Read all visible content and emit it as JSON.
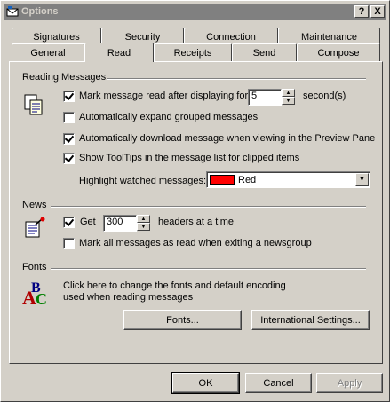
{
  "window": {
    "title": "Options",
    "help_btn": "?",
    "close_btn": "X"
  },
  "tabs": {
    "back_row": [
      "Signatures",
      "Security",
      "Connection",
      "Maintenance"
    ],
    "front_row": [
      "General",
      "Read",
      "Receipts",
      "Send",
      "Compose"
    ],
    "active": "Read"
  },
  "reading": {
    "title": "Reading Messages",
    "mark_read_label": "Mark message read after displaying for",
    "mark_read_checked": true,
    "mark_read_seconds": "5",
    "seconds_label": "second(s)",
    "expand_label": "Automatically expand grouped messages",
    "expand_checked": false,
    "download_label": "Automatically download message when viewing in the Preview Pane",
    "download_checked": true,
    "tooltips_label": "Show ToolTips in the message list for clipped items",
    "tooltips_checked": true,
    "highlight_label": "Highlight watched messages:",
    "highlight_color_name": "Red",
    "highlight_color": "#ff0000"
  },
  "news": {
    "title": "News",
    "get_label": "Get",
    "get_checked": true,
    "get_count": "300",
    "headers_label": "headers at a time",
    "mark_all_label": "Mark all messages as read when exiting a newsgroup",
    "mark_all_checked": false
  },
  "fonts": {
    "title": "Fonts",
    "description_line1": "Click here to change the fonts and default encoding",
    "description_line2": "used when reading messages",
    "fonts_button": "Fonts...",
    "intl_button": "International Settings..."
  },
  "footer": {
    "ok": "OK",
    "cancel": "Cancel",
    "apply": "Apply"
  },
  "colors": {
    "face": "#d4d0c8",
    "titlebar": "#808080",
    "swatch": "#ff0000"
  }
}
